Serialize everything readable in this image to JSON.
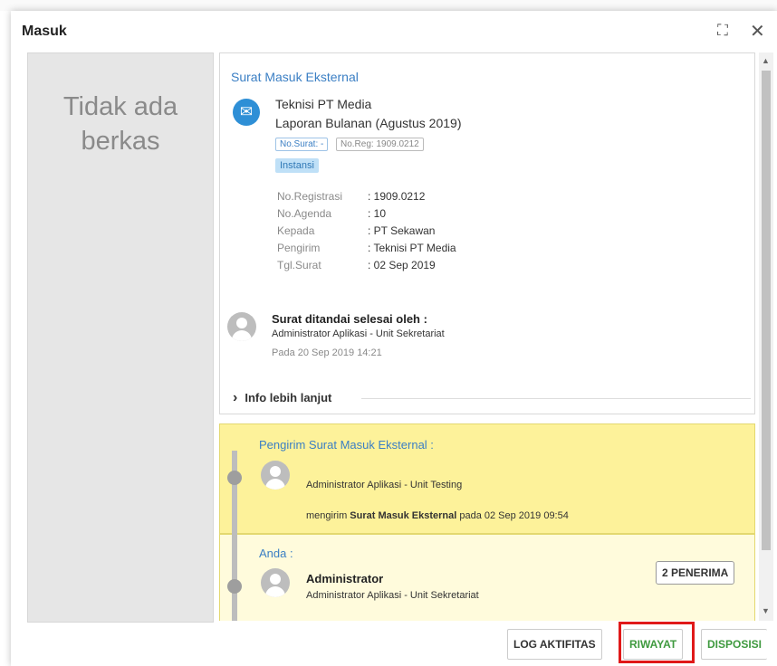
{
  "dialog": {
    "title": "Masuk",
    "expand_icon": "expand-icon",
    "close_icon": "close-icon",
    "close_glyph": "✕"
  },
  "file_panel": {
    "line1": "Tidak ada",
    "line2": "berkas"
  },
  "letter": {
    "type_label": "Surat Masuk Eksternal",
    "sender": "Teknisi PT Media",
    "subject": "Laporan Bulanan (Agustus 2019)",
    "tag_surat": "No.Surat: -",
    "tag_reg": "No.Reg: 1909.0212",
    "tag_instansi": "Instansi",
    "meta": [
      {
        "label": "No.Registrasi",
        "value": ": 1909.0212"
      },
      {
        "label": "No.Agenda",
        "value": ": 10"
      },
      {
        "label": "Kepada",
        "value": ": PT Sekawan"
      },
      {
        "label": "Pengirim",
        "value": ": Teknisi PT Media"
      },
      {
        "label": "Tgl.Surat",
        "value": ": 02 Sep 2019"
      }
    ],
    "done_title": "Surat ditandai selesai oleh :",
    "done_by": "Administrator Aplikasi - Unit Sekretariat",
    "done_date": "Pada 20 Sep 2019 14:21",
    "more_info": "Info lebih lanjut",
    "more_info_chevron": "›"
  },
  "history": [
    {
      "title": "Pengirim Surat Masuk Eksternal :",
      "who": "Administrator Aplikasi - Unit Testing",
      "action_prefix": "mengirim ",
      "action_bold": "Surat Masuk Eksternal",
      "action_suffix": " pada 02 Sep 2019 09:54"
    },
    {
      "title": "Anda :",
      "name": "Administrator",
      "who": "Administrator Aplikasi - Unit Sekretariat",
      "recipients_button": "2 PENERIMA"
    }
  ],
  "footer": {
    "log": "LOG AKTIFITAS",
    "riwayat": "RIWAYAT",
    "disposisi": "DISPOSISI"
  },
  "colors": {
    "accent": "#3b7fc4",
    "history_bg": "#fdf29a",
    "green": "#3f9a3f",
    "highlight": "#e01919"
  }
}
